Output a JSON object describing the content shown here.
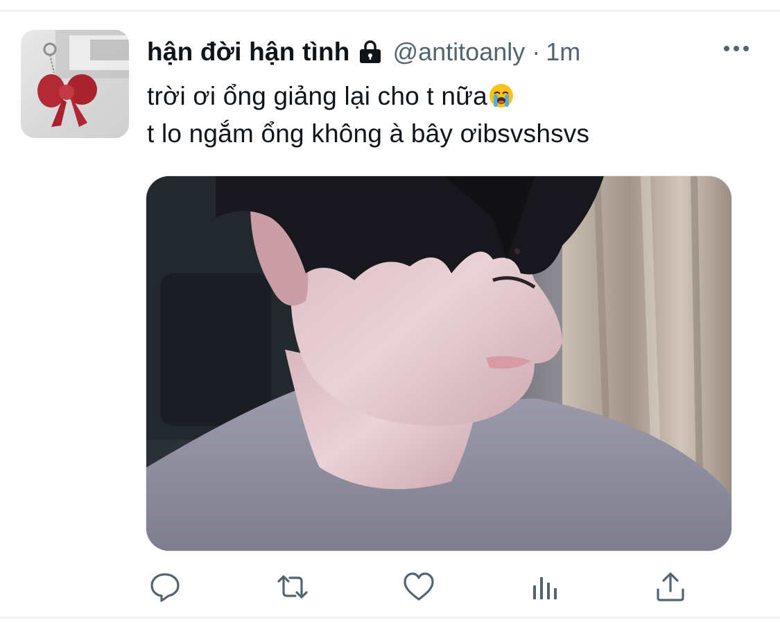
{
  "tweet": {
    "display_name": "hận đời hận tình",
    "handle": "@antitoanly",
    "separator": "·",
    "time": "1m",
    "text_lines": [
      "trời ơi ổng giảng lại cho t nữa",
      "t lo ngắm ổng không à bây ơibsvshsvs"
    ],
    "text_emoji": "loudly-crying-face-emoji",
    "protected": true
  },
  "icons": {
    "lock": "lock-icon",
    "more": "more-dots-icon",
    "reply": "reply-icon",
    "retweet": "retweet-icon",
    "like": "heart-icon",
    "analytics": "analytics-icon",
    "share": "share-icon"
  },
  "colors": {
    "text_primary": "#0f1419",
    "text_secondary": "#536471",
    "icon_gray": "#536471",
    "divider": "#eff3f4"
  }
}
